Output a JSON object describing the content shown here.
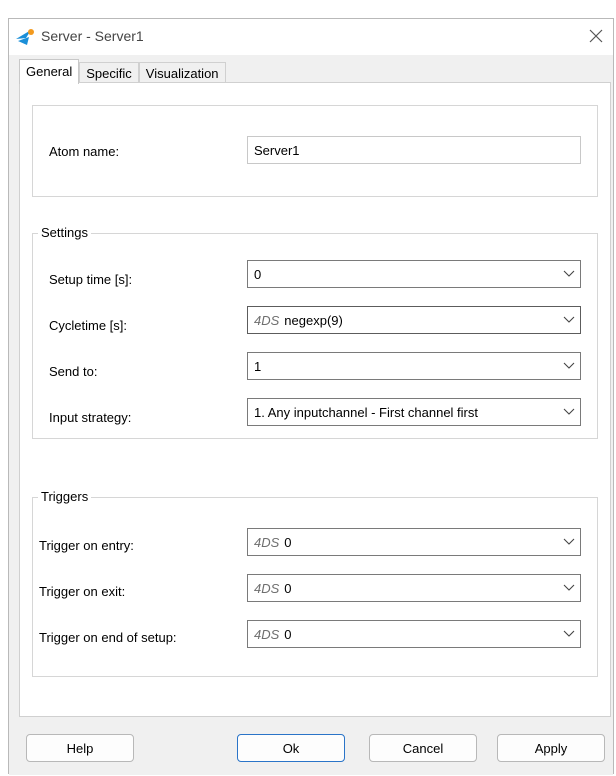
{
  "window": {
    "title": "Server - Server1"
  },
  "tabs": [
    {
      "label": "General"
    },
    {
      "label": "Specific"
    },
    {
      "label": "Visualization"
    }
  ],
  "atom": {
    "label": "Atom name:",
    "value": "Server1"
  },
  "settings": {
    "title": "Settings",
    "setup_time": {
      "label": "Setup time [s]:",
      "value": "0"
    },
    "cycletime": {
      "label": "Cycletime [s]:",
      "prefix": "4DS",
      "value": "negexp(9)"
    },
    "send_to": {
      "label": "Send to:",
      "value": "1"
    },
    "input_strategy": {
      "label": "Input strategy:",
      "value": "1. Any inputchannel -  First channel first"
    }
  },
  "triggers": {
    "title": "Triggers",
    "on_entry": {
      "label": "Trigger on entry:",
      "prefix": "4DS",
      "value": "0"
    },
    "on_exit": {
      "label": "Trigger on exit:",
      "prefix": "4DS",
      "value": "0"
    },
    "on_end_setup": {
      "label": "Trigger on end of setup:",
      "prefix": "4DS",
      "value": "0"
    }
  },
  "buttons": {
    "help": "Help",
    "ok": "Ok",
    "cancel": "Cancel",
    "apply": "Apply"
  },
  "colors": {
    "accent": "#2a74c8",
    "icon_blue": "#1b8fd8",
    "icon_orange": "#f39a1e"
  }
}
